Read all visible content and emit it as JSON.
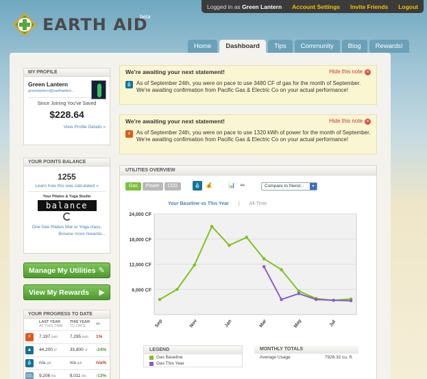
{
  "userbar": {
    "logged_in_prefix": "Logged in as",
    "username": "Green Lantern",
    "links": [
      "Account Settings",
      "Invite Friends",
      "Logout"
    ]
  },
  "logo": {
    "part1": "EARTH",
    "part2": "AID",
    "badge": "beta"
  },
  "nav": {
    "tabs": [
      "Home",
      "Dashboard",
      "Tips",
      "Community",
      "Blog",
      "Rewards!"
    ],
    "active": "Dashboard"
  },
  "profile": {
    "title": "MY PROFILE",
    "name": "Green Lantern",
    "email": "greenlantern@earthaidert...",
    "saved_label": "Since Joining You've Saved",
    "saved_value": "$228.64",
    "details_link": "View Profile Details »"
  },
  "points": {
    "title": "YOUR POINTS BALANCE",
    "value": "1255",
    "calc_link": "Learn how this was calculated »",
    "studio": "Your Pilates & Yoga Studio",
    "sponsor": "balance",
    "promo": "One free Pilates Mat or Yoga class.",
    "more_link": "Browse more rewards..."
  },
  "buttons": {
    "manage": "Manage My Utilities",
    "rewards": "View My Rewards"
  },
  "progress": {
    "title": "YOUR PROGRESS TO DATE",
    "col_last": "LAST YEAR",
    "col_last_sub": "AT THIS TIME",
    "col_this": "THIS YEAR",
    "col_this_sub": "TO DATE",
    "col_delta": "+/-",
    "rows": [
      {
        "icon": "power",
        "color": "#e05a1e",
        "last": "7,197",
        "last_unit": "kwh",
        "this": "7,295",
        "this_unit": "kwh",
        "delta": "1%",
        "dir": "pos"
      },
      {
        "icon": "gas",
        "color": "#1d6f8c",
        "last": "44,200",
        "last_unit": "cf",
        "this": "33,800",
        "this_unit": "cf",
        "delta": "-24%",
        "dir": "neg"
      },
      {
        "icon": "water",
        "color": "#1d6f8c",
        "last": "n/a",
        "last_unit": "gal",
        "this": "n/a",
        "this_unit": "gal",
        "delta": "n/a%",
        "dir": "pos"
      },
      {
        "icon": "co2",
        "color": "#6aa1b8",
        "last": "9,206",
        "last_unit": "lbs",
        "this": "8,011",
        "this_unit": "lbs",
        "delta": "-13%",
        "dir": "neg"
      }
    ]
  },
  "notes": [
    {
      "title": "We're awaiting your next statement!",
      "hide": "Hide this note",
      "icon": "gas",
      "color": "#1d6f8c",
      "text": "As of September 24th, you were on pace to use 3480 CF of gas for the month of September. We're awaiting confirmation from Pacific Gas & Electric Co on your actual performance!"
    },
    {
      "title": "We're awaiting your next statement!",
      "hide": "Hide this note",
      "icon": "power",
      "color": "#e05a1e",
      "text": "As of September 24th, you were on pace to use 1320 kWh of power for the month of September. We're awaiting confirmation from Pacific Gas & Electric Co on your actual performance!"
    }
  ],
  "utilities": {
    "title": "UTILITIES OVERVIEW",
    "pills": [
      "Gas",
      "Power",
      "CO2"
    ],
    "compare": "Compare to friend...",
    "chart_tab_active": "Your Baseline vs This Year",
    "chart_tab_other": "All-Time",
    "legend_title": "LEGEND",
    "monthly_title": "MONTHLY TOTALS",
    "avg_label": "Average Usage",
    "avg_value": "7926.32 cu. ft."
  },
  "chart_data": {
    "type": "line",
    "ylim": [
      0,
      24000
    ],
    "yticks": [
      "6,000 CF",
      "12,000 CF",
      "18,000 CF",
      "24,000 CF"
    ],
    "ytick_values": [
      6000,
      12000,
      18000,
      24000
    ],
    "xticks": [
      "Sep",
      "Nov",
      "Jan",
      "Mar",
      "May",
      "Jul"
    ],
    "xtick_index": [
      0,
      2,
      4,
      6,
      8,
      10
    ],
    "series": [
      {
        "name": "Gas Baseline",
        "color": "#7dc21e",
        "values": [
          3600,
          6000,
          11800,
          21000,
          16500,
          18400,
          13300,
          10700,
          5600,
          3800,
          3400,
          3700
        ]
      },
      {
        "name": "Gas This Year",
        "color": "#8a5cc7",
        "start": 6,
        "values": [
          11400,
          3600,
          5000,
          3600,
          3400,
          3300
        ]
      }
    ]
  }
}
